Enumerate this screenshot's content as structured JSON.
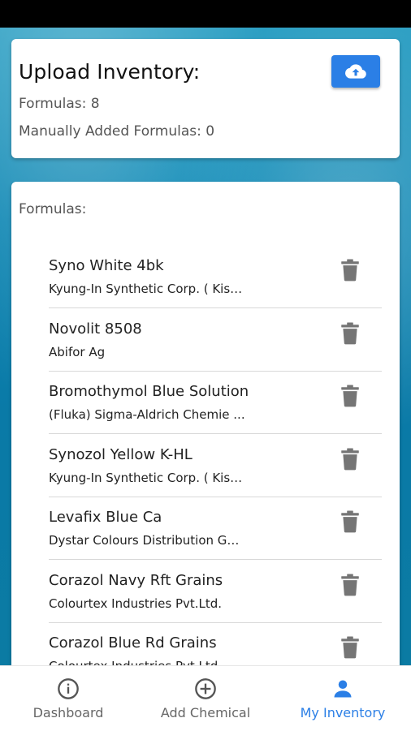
{
  "upload": {
    "title": "Upload Inventory:",
    "formulas_count": "Formulas: 8",
    "manual_count": "Manually Added Formulas: 0"
  },
  "formulas": {
    "heading": "Formulas:",
    "items": [
      {
        "name": "Syno White 4bk",
        "maker": "Kyung-In Synthetic Corp. ( Kisc..."
      },
      {
        "name": "Novolit 8508",
        "maker": "Abifor Ag"
      },
      {
        "name": "Bromothymol Blue Solution",
        "maker": "(Fluka) Sigma-Aldrich Chemie ..."
      },
      {
        "name": "Synozol Yellow K-HL",
        "maker": "Kyung-In Synthetic Corp. ( Kisc..."
      },
      {
        "name": "Levafix Blue Ca",
        "maker": "Dystar Colours Distribution Gm..."
      },
      {
        "name": "Corazol Navy Rft Grains",
        "maker": "Colourtex Industries Pvt.Ltd."
      },
      {
        "name": "Corazol Blue Rd Grains",
        "maker": "Colourtex Industries Pvt.Ltd."
      }
    ]
  },
  "nav": {
    "dashboard": "Dashboard",
    "add_chemical": "Add Chemical",
    "my_inventory": "My Inventory"
  },
  "colors": {
    "accent": "#2b7fe6",
    "trash": "#757575"
  },
  "icons": {
    "upload": "cloud-upload-icon",
    "trash": "trash-icon",
    "dashboard": "info-icon",
    "add": "add-circle-icon",
    "inventory": "person-icon"
  }
}
